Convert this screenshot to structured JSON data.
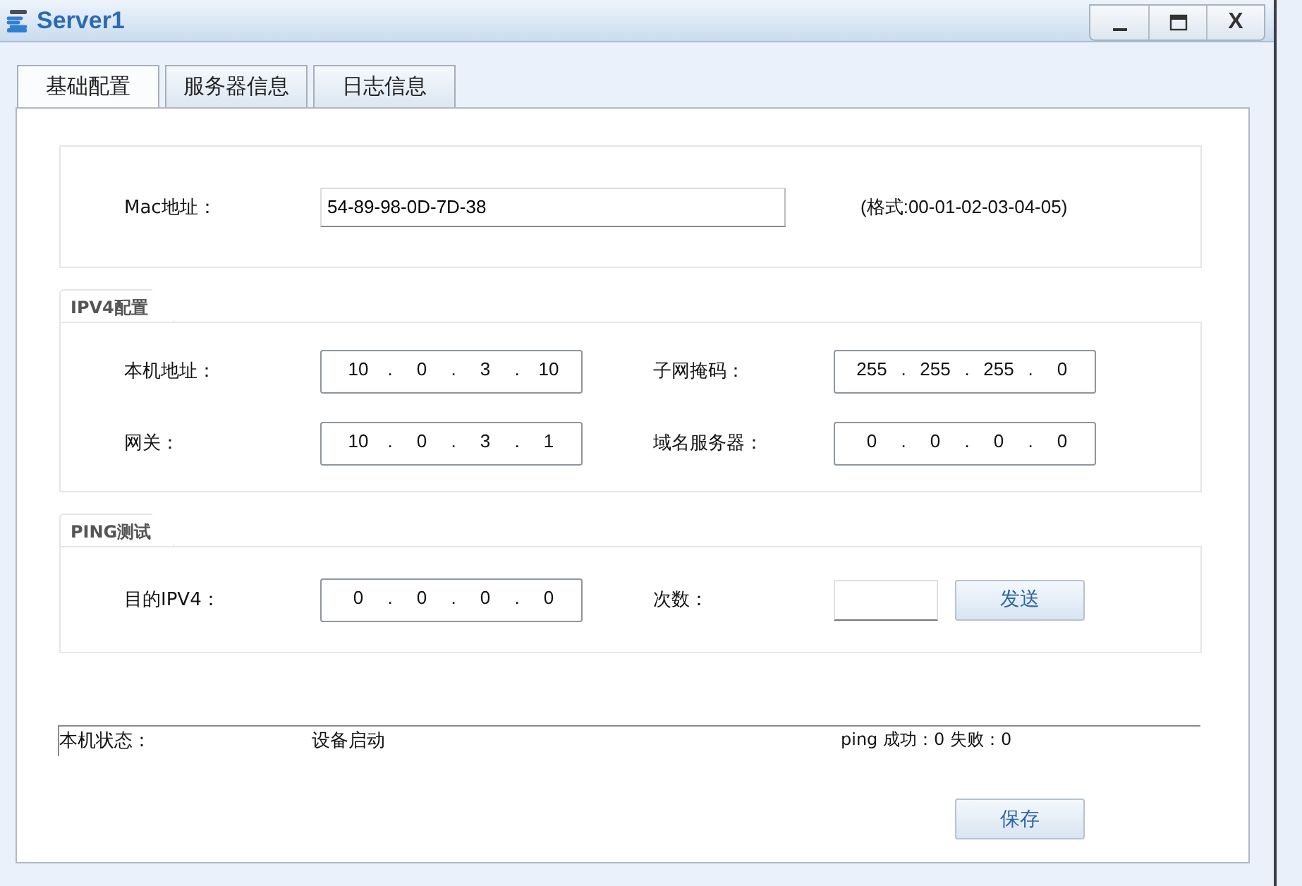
{
  "window": {
    "title": "Server1",
    "controls": [
      {
        "kind": "minimize"
      },
      {
        "kind": "maximize"
      },
      {
        "kind": "close",
        "label": "X"
      }
    ]
  },
  "tabs": [
    {
      "label": "基础配置",
      "selected": true
    },
    {
      "label": "服务器信息",
      "selected": false
    },
    {
      "label": "日志信息",
      "selected": false
    }
  ],
  "mac": {
    "label": "Mac地址：",
    "value": "54-89-98-0D-7D-38",
    "hint": "(格式:00-01-02-03-04-05)"
  },
  "ipv4": {
    "title": "IPV4配置",
    "separator": ".",
    "fields": [
      {
        "label": "本机地址：",
        "octets": [
          "10",
          "0",
          "3",
          "10"
        ]
      },
      {
        "label": "子网掩码：",
        "octets": [
          "255",
          "255",
          "255",
          "0"
        ]
      },
      {
        "label": "网关：",
        "octets": [
          "10",
          "0",
          "3",
          "1"
        ]
      },
      {
        "label": "域名服务器：",
        "octets": [
          "0",
          "0",
          "0",
          "0"
        ]
      }
    ]
  },
  "ping": {
    "title": "PING测试",
    "separator": ".",
    "target_label": "目的IPV4：",
    "target_octets": [
      "0",
      "0",
      "0",
      "0"
    ],
    "count_label": "次数：",
    "send_button": "发送"
  },
  "status_bar": {
    "label": "本机状态：",
    "value": "设备启动",
    "ping_result": "ping 成功：0 失败：0"
  },
  "save_button": "保存"
}
